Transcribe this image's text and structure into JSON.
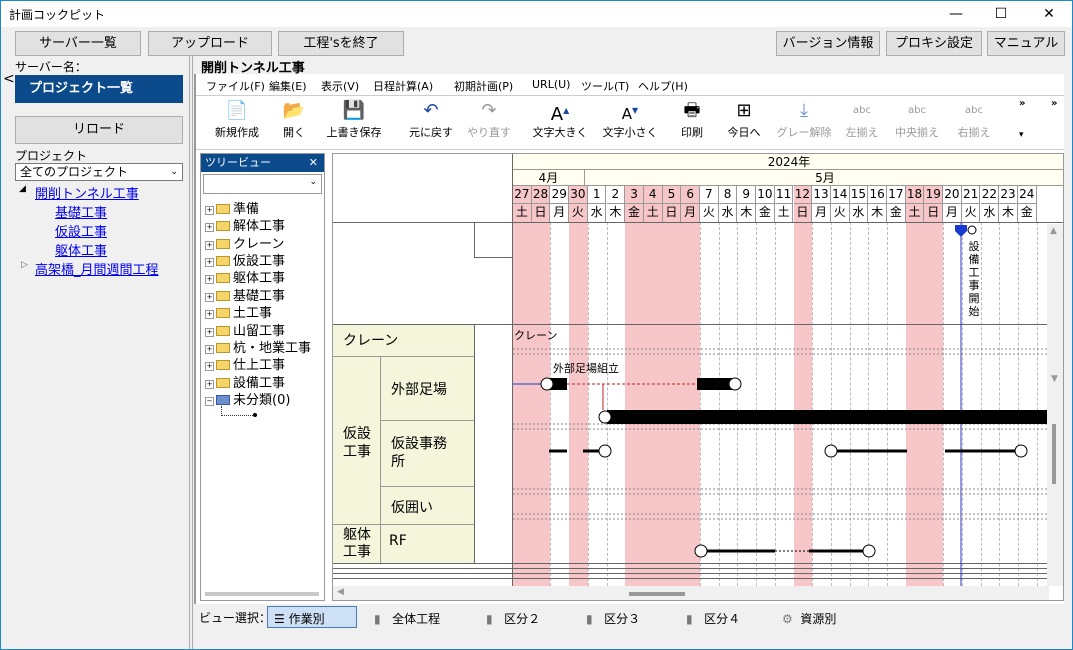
{
  "window": {
    "title": "計画コックピット"
  },
  "topbar": {
    "server_list": "サーバー一覧",
    "upload": "アップロード",
    "exit": "工程'sを終了",
    "version": "バージョン情報",
    "proxy": "プロキシ設定",
    "manual": "マニュアル"
  },
  "left": {
    "server_label": "サーバー名：",
    "project_list": "プロジェクト一覧",
    "reload": "リロード",
    "project_label": "プロジェクト",
    "filter": "全てのプロジェクト",
    "projects": [
      "開削トンネル工事",
      "基礎工事",
      "仮設工事",
      "躯体工事",
      "高架橋_月間週間工程"
    ]
  },
  "main": {
    "title": "開削トンネル工事"
  },
  "menu": [
    "ファイル(F)",
    "編集(E)",
    "表示(V)",
    "日程計算(A)",
    "初期計画(P)",
    "URL(U)",
    "ツール(T)",
    "ヘルプ(H)"
  ],
  "toolbar": [
    "新規作成",
    "開く",
    "上書き保存",
    "元に戻す",
    "やり直す",
    "文字大きく",
    "文字小さく",
    "印刷",
    "今日へ",
    "グレー解除",
    "左揃え",
    "中央揃え",
    "右揃え"
  ],
  "treeview": {
    "title": "ツリービュー",
    "folders": [
      "準備",
      "解体工事",
      "クレーン",
      "仮設工事",
      "躯体工事",
      "基礎工事",
      "土工事",
      "山留工事",
      "杭・地業工事",
      "仕上工事",
      "設備工事",
      "未分類(0)"
    ]
  },
  "gantt": {
    "year": "2024年",
    "april": "4月",
    "may": "5月",
    "days": [
      "27",
      "28",
      "29",
      "30",
      "1",
      "2",
      "3",
      "4",
      "5",
      "6",
      "7",
      "8",
      "9",
      "10",
      "11",
      "12",
      "13",
      "14",
      "15",
      "16",
      "17",
      "18",
      "19",
      "20",
      "21",
      "22",
      "23",
      "24"
    ],
    "weekdays": [
      "土",
      "日",
      "月",
      "火",
      "水",
      "木",
      "金",
      "土",
      "日",
      "月",
      "火",
      "水",
      "木",
      "金",
      "土",
      "日",
      "月",
      "火",
      "水",
      "木",
      "金",
      "土",
      "日",
      "月",
      "火",
      "水",
      "木",
      "金"
    ],
    "rows": {
      "crane": "クレーン",
      "temp1": "仮設",
      "temp2": "工事",
      "scaffold": "外部足場",
      "office1": "仮設事務",
      "office2": "所",
      "fence": "仮囲い",
      "body1": "躯体",
      "body2": "工事",
      "rf": "RF"
    },
    "bar_labels": {
      "crane": "クレーン",
      "scaffold": "外部足場組立"
    },
    "milestone": [
      "設",
      "備",
      "工",
      "事",
      "開",
      "始"
    ]
  },
  "viewbar": {
    "label": "ビュー選択：",
    "items": [
      "作業別",
      "全体工程",
      "区分２",
      "区分３",
      "区分４",
      "資源別"
    ]
  }
}
